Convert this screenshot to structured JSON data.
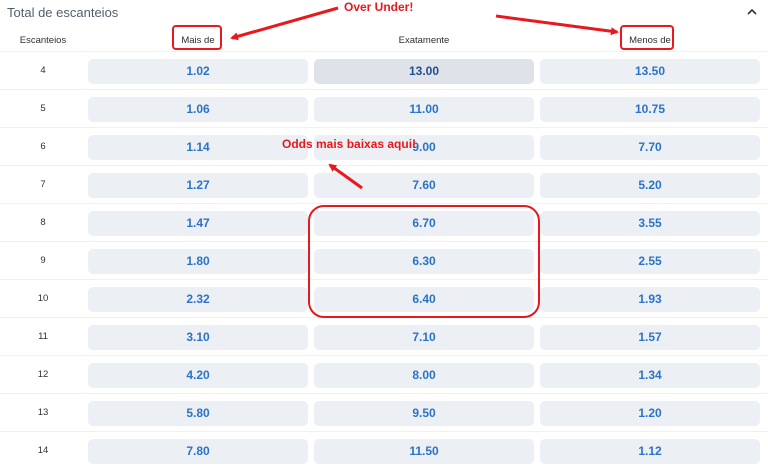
{
  "panel": {
    "title": "Total de escanteios",
    "collapse_icon": "chevron-up-icon"
  },
  "columns": {
    "escanteios": "Escanteios",
    "mais": "Mais de",
    "exatamente": "Exatamente",
    "menos": "Menos de"
  },
  "rows": [
    {
      "n": "4",
      "mais": "1.02",
      "exatamente": "13.00",
      "menos": "13.50"
    },
    {
      "n": "5",
      "mais": "1.06",
      "exatamente": "11.00",
      "menos": "10.75"
    },
    {
      "n": "6",
      "mais": "1.14",
      "exatamente": "9.00",
      "menos": "7.70"
    },
    {
      "n": "7",
      "mais": "1.27",
      "exatamente": "7.60",
      "menos": "5.20"
    },
    {
      "n": "8",
      "mais": "1.47",
      "exatamente": "6.70",
      "menos": "3.55"
    },
    {
      "n": "9",
      "mais": "1.80",
      "exatamente": "6.30",
      "menos": "2.55"
    },
    {
      "n": "10",
      "mais": "2.32",
      "exatamente": "6.40",
      "menos": "1.93"
    },
    {
      "n": "11",
      "mais": "3.10",
      "exatamente": "7.10",
      "menos": "1.57"
    },
    {
      "n": "12",
      "mais": "4.20",
      "exatamente": "8.00",
      "menos": "1.34"
    },
    {
      "n": "13",
      "mais": "5.80",
      "exatamente": "9.50",
      "menos": "1.20"
    },
    {
      "n": "14",
      "mais": "7.80",
      "exatamente": "11.50",
      "menos": "1.12"
    }
  ],
  "annotations": {
    "over_under": "Over Under!",
    "odds_low": "Odds mais baixas aqui!",
    "color": "#e8181d"
  },
  "colors": {
    "odd_text": "#2a73c9",
    "odd_bg": "#eceff3",
    "annotation": "#e8181d"
  }
}
